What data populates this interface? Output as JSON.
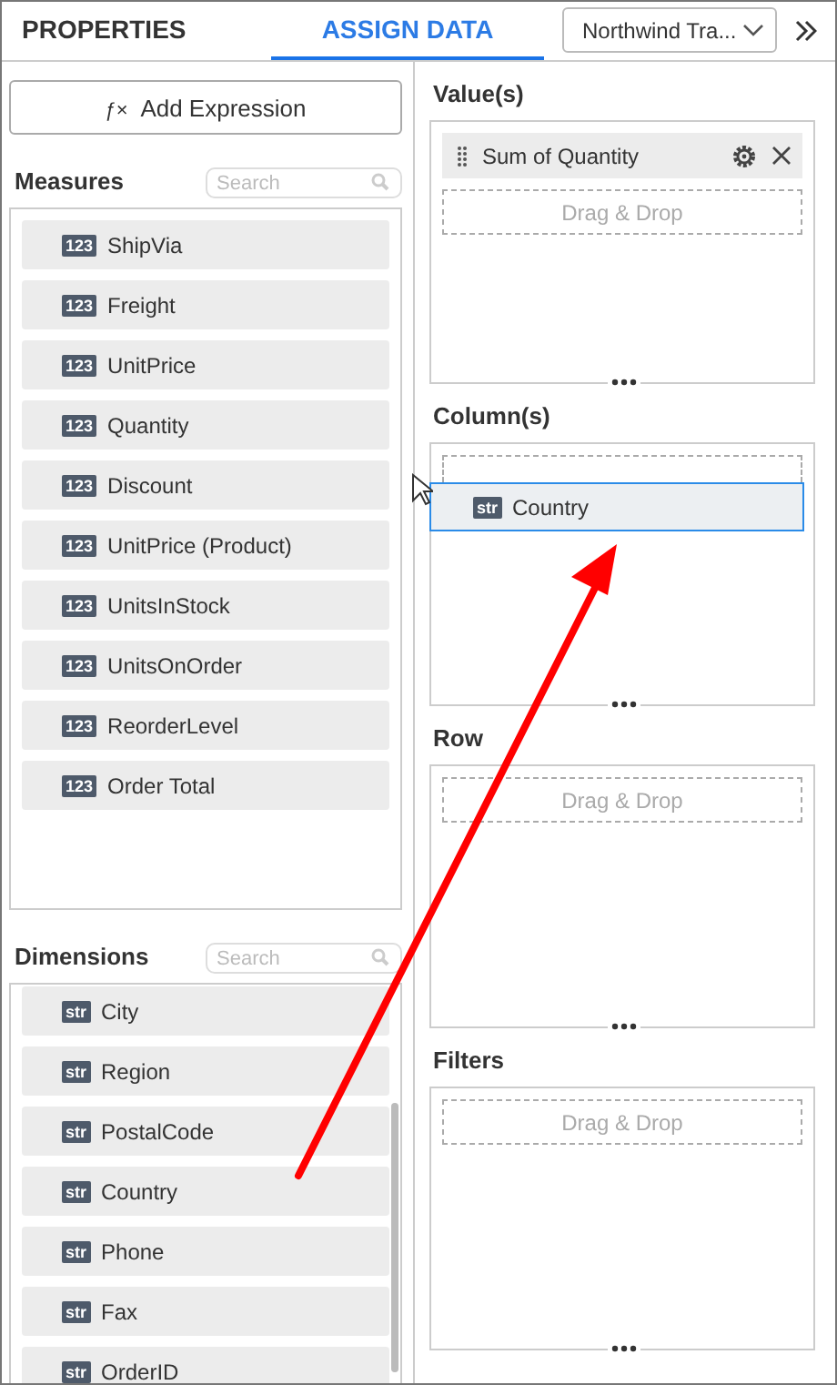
{
  "tabs": [
    {
      "label": "PROPERTIES",
      "selected": false
    },
    {
      "label": "ASSIGN DATA",
      "selected": true
    }
  ],
  "datasource": {
    "value": "Northwind Tra..."
  },
  "add_expression": {
    "icon": "ƒ×",
    "label": "Add Expression"
  },
  "measures": {
    "title": "Measures",
    "search": {
      "placeholder": "Search"
    },
    "items": [
      {
        "type": "123",
        "label": "ShipVia"
      },
      {
        "type": "123",
        "label": "Freight"
      },
      {
        "type": "123",
        "label": "UnitPrice"
      },
      {
        "type": "123",
        "label": "Quantity"
      },
      {
        "type": "123",
        "label": "Discount"
      },
      {
        "type": "123",
        "label": "UnitPrice (Product)"
      },
      {
        "type": "123",
        "label": "UnitsInStock"
      },
      {
        "type": "123",
        "label": "UnitsOnOrder"
      },
      {
        "type": "123",
        "label": "ReorderLevel"
      },
      {
        "type": "123",
        "label": "Order Total"
      }
    ]
  },
  "dimensions": {
    "title": "Dimensions",
    "search": {
      "placeholder": "Search"
    },
    "items": [
      {
        "type": "str",
        "label": "City"
      },
      {
        "type": "str",
        "label": "Region"
      },
      {
        "type": "str",
        "label": "PostalCode"
      },
      {
        "type": "str",
        "label": "Country"
      },
      {
        "type": "str",
        "label": "Phone"
      },
      {
        "type": "str",
        "label": "Fax"
      },
      {
        "type": "str",
        "label": "OrderID"
      }
    ]
  },
  "sections": [
    {
      "title": "Value(s)",
      "items": [
        {
          "label": "Sum of Quantity"
        }
      ],
      "drop_hint": "Drag & Drop"
    },
    {
      "title": "Column(s)",
      "dragging": {
        "type": "str",
        "label": "Country"
      }
    },
    {
      "title": "Row",
      "drop_hint": "Drag & Drop"
    },
    {
      "title": "Filters",
      "drop_hint": "Drag & Drop"
    }
  ]
}
